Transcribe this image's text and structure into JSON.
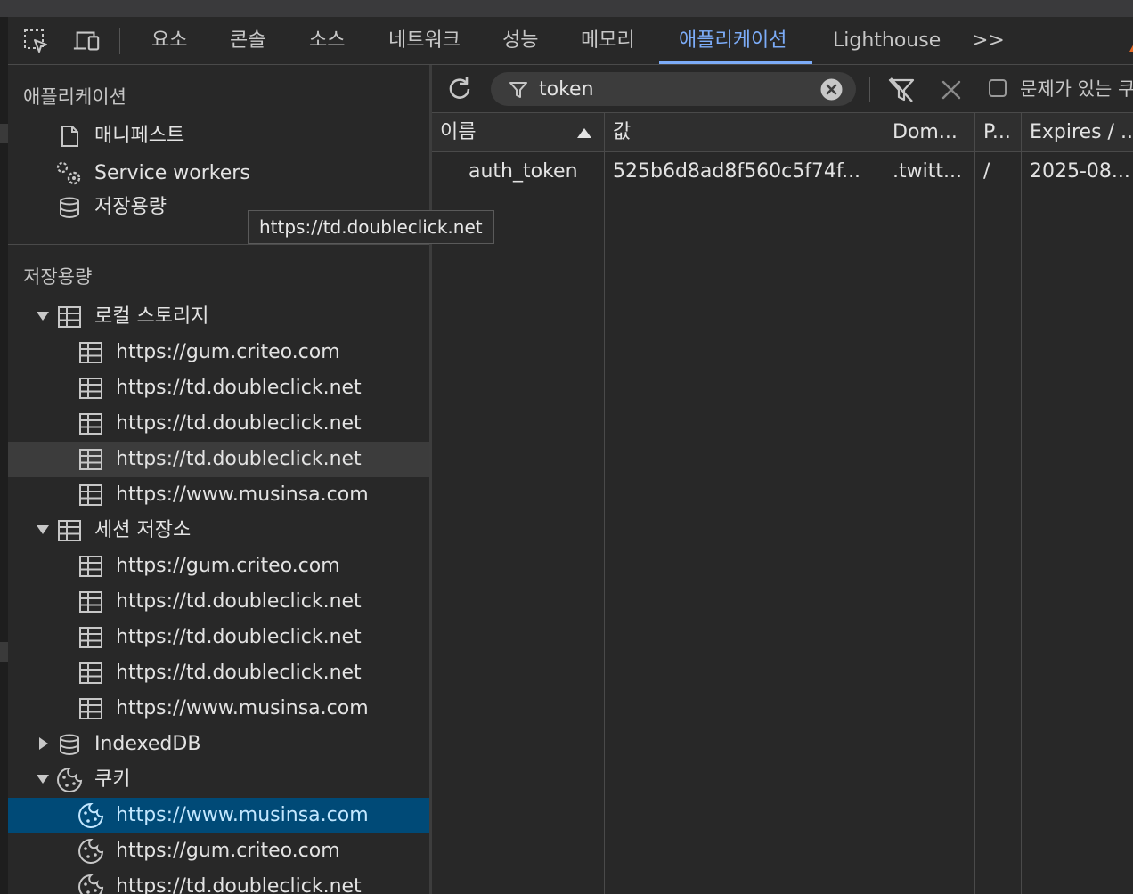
{
  "tabs": [
    "요소",
    "콘솔",
    "소스",
    "네트워크",
    "성능",
    "메모리",
    "애플리케이션",
    "Lighthouse"
  ],
  "tabs_more": ">>",
  "sidebar": {
    "app_section_title": "애플리케이션",
    "app_items": [
      "매니페스트",
      "Service workers",
      "저장용량"
    ],
    "storage_section_title": "저장용량",
    "local_storage": {
      "label": "로컬 스토리지",
      "items": [
        "https://gum.criteo.com",
        "https://td.doubleclick.net",
        "https://td.doubleclick.net",
        "https://td.doubleclick.net",
        "https://www.musinsa.com"
      ]
    },
    "session_storage": {
      "label": "세션 저장소",
      "items": [
        "https://gum.criteo.com",
        "https://td.doubleclick.net",
        "https://td.doubleclick.net",
        "https://td.doubleclick.net",
        "https://www.musinsa.com"
      ]
    },
    "indexeddb_label": "IndexedDB",
    "cookies": {
      "label": "쿠키",
      "items": [
        "https://www.musinsa.com",
        "https://gum.criteo.com",
        "https://td.doubleclick.net"
      ]
    }
  },
  "tooltip": "https://td.doubleclick.net",
  "toolbar": {
    "filter_value": "token",
    "checkbox_label": "문제가 있는 쿠"
  },
  "table": {
    "headers": [
      "이름",
      "값",
      "Dom...",
      "P...",
      "Expires / ..."
    ],
    "rows": [
      [
        "auth_token",
        "525b6d8ad8f560c5f74f...",
        ".twitt...",
        "/",
        "2025-08..."
      ]
    ]
  },
  "colors": {
    "accent": "#7cacf8",
    "selected_row": "#004a77",
    "warning": "#e46a25"
  }
}
